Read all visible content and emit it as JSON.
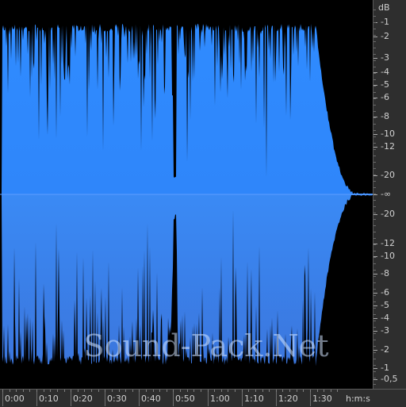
{
  "watermark": "Sound-Pack.Net",
  "db_ruler": {
    "unit": "dB",
    "labels": [
      "-1",
      "-2",
      "-3",
      "-4",
      "-5",
      "-6",
      "-8",
      "-10",
      "-12",
      "-20",
      "-∞",
      "-20",
      "-12",
      "-10",
      "-8",
      "-6",
      "-5",
      "-4",
      "-3",
      "-2",
      "-1",
      "-0,5"
    ]
  },
  "time_ruler": {
    "labels": [
      "0:00",
      "0:10",
      "0:20",
      "0:30",
      "0:40",
      "0:50",
      "1:00",
      "1:10",
      "1:20",
      "1:30"
    ],
    "unit_label": "h:m:s"
  },
  "colors": {
    "waveform_top": "#2f89ff",
    "waveform_bottom": "#3a7ce6",
    "background": "#000000",
    "ruler_bg": "#2e2e2e"
  },
  "waveform": {
    "duration_s": 98,
    "fade_out_start_s": 88,
    "dropout_s": 47
  }
}
